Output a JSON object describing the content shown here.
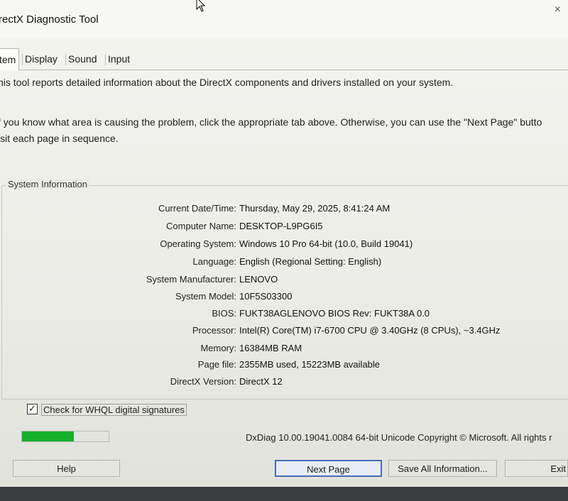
{
  "window": {
    "title": "rectX Diagnostic Tool"
  },
  "tabs": [
    {
      "label": "tem",
      "active": true
    },
    {
      "label": "Display",
      "active": false
    },
    {
      "label": "Sound",
      "active": false
    },
    {
      "label": "Input",
      "active": false
    }
  ],
  "intro": "his tool reports detailed information about the DirectX components and drivers installed on your system.",
  "hint": {
    "line1": "f you know what area is causing the problem, click the appropriate tab above.  Otherwise, you can use the \"Next Page\" butto",
    "line2": "isit each page in sequence."
  },
  "system_info": {
    "title": "System Information",
    "rows": [
      {
        "label": "Current Date/Time:",
        "value": "Thursday, May 29, 2025, 8:41:24 AM"
      },
      {
        "label": "Computer Name:",
        "value": "DESKTOP-L9PG6I5"
      },
      {
        "label": "Operating System:",
        "value": "Windows 10 Pro 64-bit (10.0, Build 19041)"
      },
      {
        "label": "Language:",
        "value": "English (Regional Setting: English)"
      },
      {
        "label": "System Manufacturer:",
        "value": "LENOVO"
      },
      {
        "label": "System Model:",
        "value": "10F5S03300"
      },
      {
        "label": "BIOS:",
        "value": "FUKT38AGLENOVO BIOS Rev: FUKT38A 0.0"
      },
      {
        "label": "Processor:",
        "value": "Intel(R) Core(TM) i7-6700 CPU @ 3.40GHz (8 CPUs), ~3.4GHz"
      },
      {
        "label": "Memory:",
        "value": "16384MB RAM"
      },
      {
        "label": "Page file:",
        "value": "2355MB used, 15223MB available"
      },
      {
        "label": "DirectX Version:",
        "value": "DirectX 12"
      }
    ]
  },
  "whql": {
    "label": "Check for WHQL digital signatures",
    "checked": true,
    "check_glyph": "✓"
  },
  "progress": {
    "fraction": 0.6
  },
  "version_text": "DxDiag 10.00.19041.0084 64-bit Unicode  Copyright © Microsoft. All rights r",
  "buttons": {
    "help": "Help",
    "next_page": "Next Page",
    "save_all": "Save All Information...",
    "exit": "Exit"
  },
  "close_glyph": "×",
  "colors": {
    "progress": "#14b02c",
    "default_button_border": "#3d6fb5"
  }
}
